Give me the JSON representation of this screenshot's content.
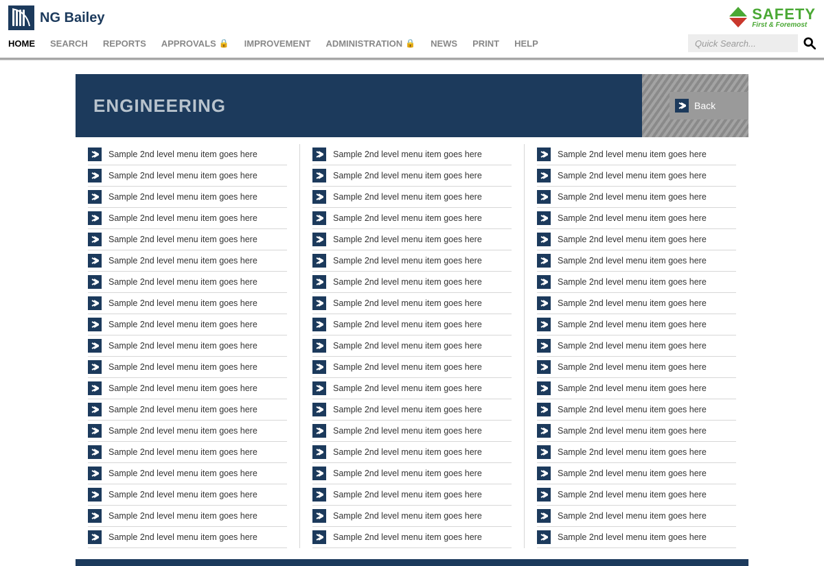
{
  "brand": {
    "name": "NG Bailey"
  },
  "safety": {
    "main": "SAFETY",
    "sub": "First & Foremost"
  },
  "nav": {
    "items": [
      {
        "label": "HOME",
        "active": true,
        "locked": false
      },
      {
        "label": "SEARCH",
        "active": false,
        "locked": false
      },
      {
        "label": "REPORTS",
        "active": false,
        "locked": false
      },
      {
        "label": "APPROVALS",
        "active": false,
        "locked": true
      },
      {
        "label": "IMPROVEMENT",
        "active": false,
        "locked": false
      },
      {
        "label": "ADMINISTRATION",
        "active": false,
        "locked": true
      },
      {
        "label": "NEWS",
        "active": false,
        "locked": false
      },
      {
        "label": "PRINT",
        "active": false,
        "locked": false
      },
      {
        "label": "HELP",
        "active": false,
        "locked": false
      }
    ]
  },
  "search": {
    "placeholder": "Quick Search..."
  },
  "banner": {
    "title": "ENGINEERING",
    "back": "Back"
  },
  "menu_item_label": "Sample 2nd level menu item goes here",
  "columns": 3,
  "rows_per_column": 19
}
